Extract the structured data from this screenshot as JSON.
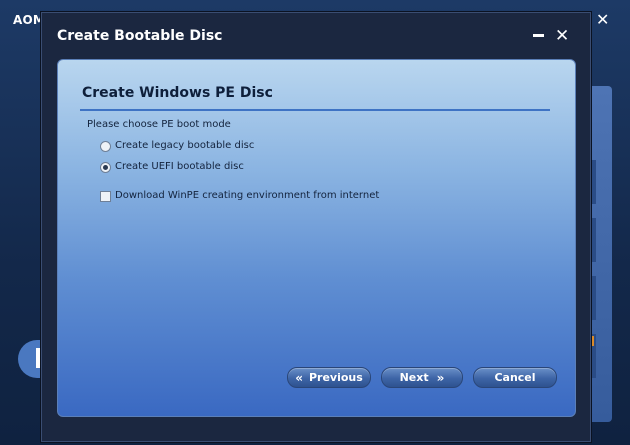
{
  "background_app": {
    "title": "AOM",
    "close_glyph": "✕"
  },
  "dialog": {
    "title": "Create Bootable Disc",
    "minimize_icon": "minimize-icon",
    "close_glyph": "✕"
  },
  "content": {
    "heading": "Create Windows PE Disc",
    "prompt": "Please choose PE boot mode",
    "options": [
      {
        "label": "Create legacy bootable disc",
        "selected": false
      },
      {
        "label": "Create UEFI bootable disc",
        "selected": true
      }
    ],
    "download_checkbox": {
      "label": "Download WinPE creating environment from internet",
      "checked": false
    }
  },
  "buttons": {
    "previous": "Previous",
    "previous_arrow": "«",
    "next": "Next",
    "next_arrow": "»",
    "cancel": "Cancel"
  }
}
